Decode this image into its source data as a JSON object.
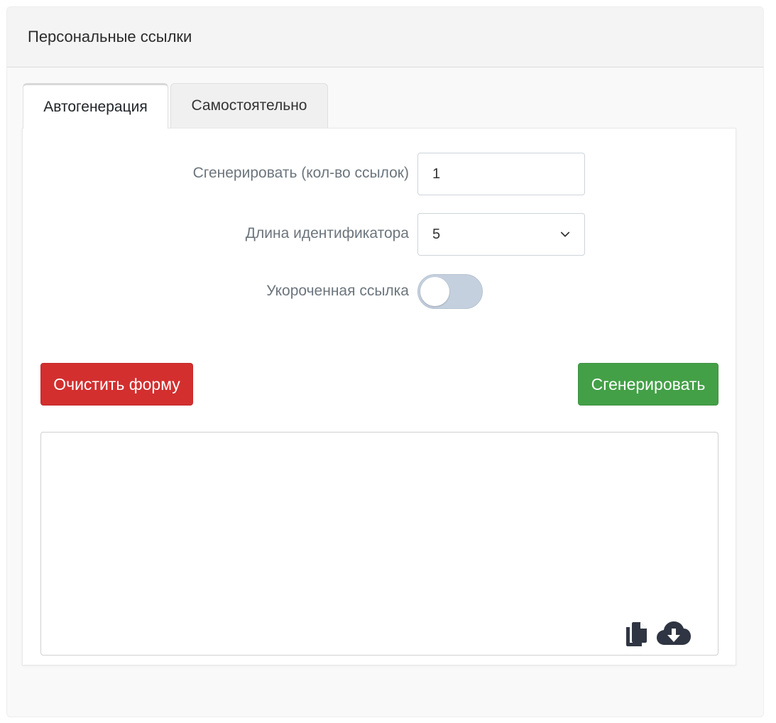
{
  "header": {
    "title": "Персональные ссылки"
  },
  "tabs": [
    {
      "label": "Автогенерация",
      "active": true
    },
    {
      "label": "Самостоятельно",
      "active": false
    }
  ],
  "form": {
    "count": {
      "label": "Сгенерировать (кол-во ссылок)",
      "value": "1"
    },
    "id_length": {
      "label": "Длина идентификатора",
      "value": "5"
    },
    "short_link": {
      "label": "Укороченная ссылка",
      "enabled": false
    }
  },
  "buttons": {
    "clear": "Очистить форму",
    "generate": "Сгенерировать"
  },
  "output": {
    "value": "",
    "icons": [
      "copy-icon",
      "cloud-download-icon"
    ]
  },
  "colors": {
    "danger": "#d32f2f",
    "success": "#43a047",
    "toggle_off": "#c5d0de",
    "icon": "#2f3542"
  }
}
